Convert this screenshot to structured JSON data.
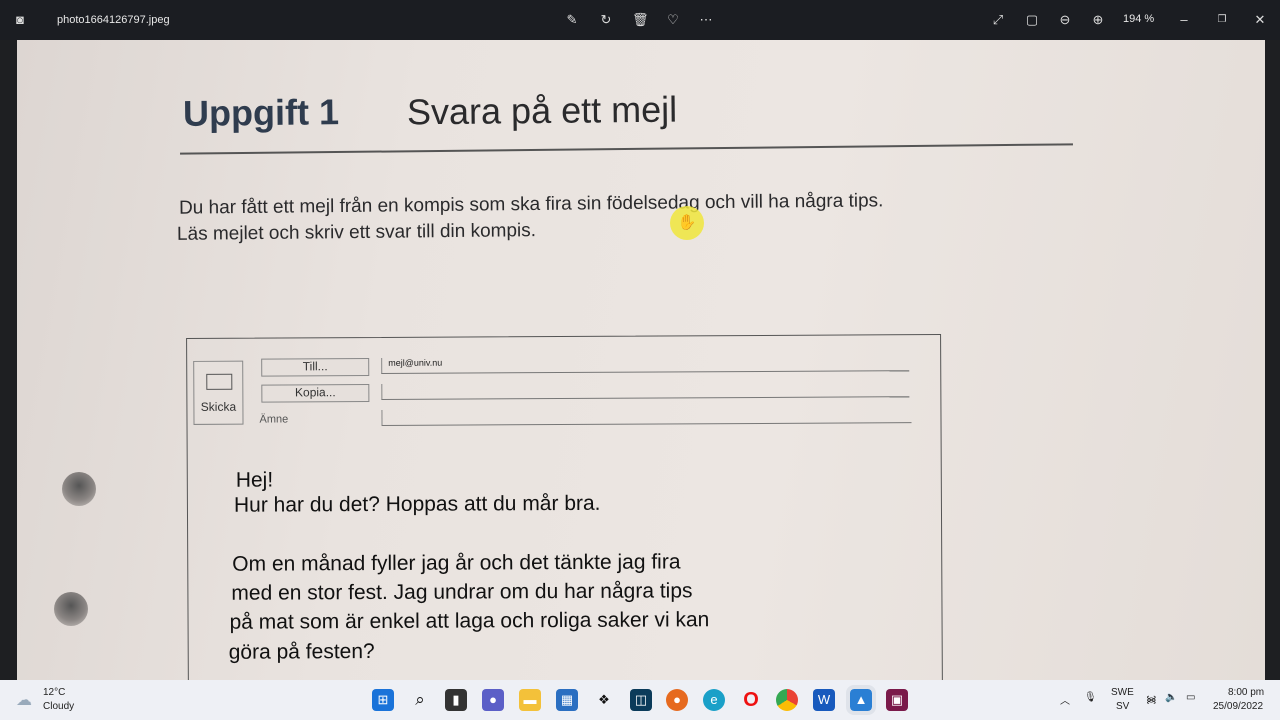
{
  "titlebar": {
    "filename": "photo1664126797.jpeg",
    "zoom": "194 %"
  },
  "document": {
    "heading_bold": "Uppgift 1",
    "heading_rest": "Svara på ett mejl",
    "intro": [
      "Du har fått ett mejl från en kompis som ska fira sin födelsedag och vill ha några tips.",
      "Läs mejlet och skriv ett svar till din kompis."
    ],
    "email": {
      "send": "Skicka",
      "to_button": "Till...",
      "cc_button": "Kopia...",
      "subject_label": "Ämne",
      "to_value": "mejl@univ.nu",
      "body": [
        "Hej!",
        "Hur har du det? Hoppas att du mår bra.",
        "Om en månad fyller jag år och det tänkte jag fira",
        "med en stor fest. Jag undrar om du har några tips",
        "på mat som är enkel att laga och roliga saker vi kan",
        "göra på festen?"
      ]
    }
  },
  "taskbar": {
    "temp": "12°C",
    "weather": "Cloudy",
    "lang1": "SWE",
    "lang2": "SV",
    "time": "8:00 pm",
    "date": "25/09/2022"
  },
  "colors": {
    "highlight": "#f0e63c",
    "heading": "#2f3c4e"
  }
}
